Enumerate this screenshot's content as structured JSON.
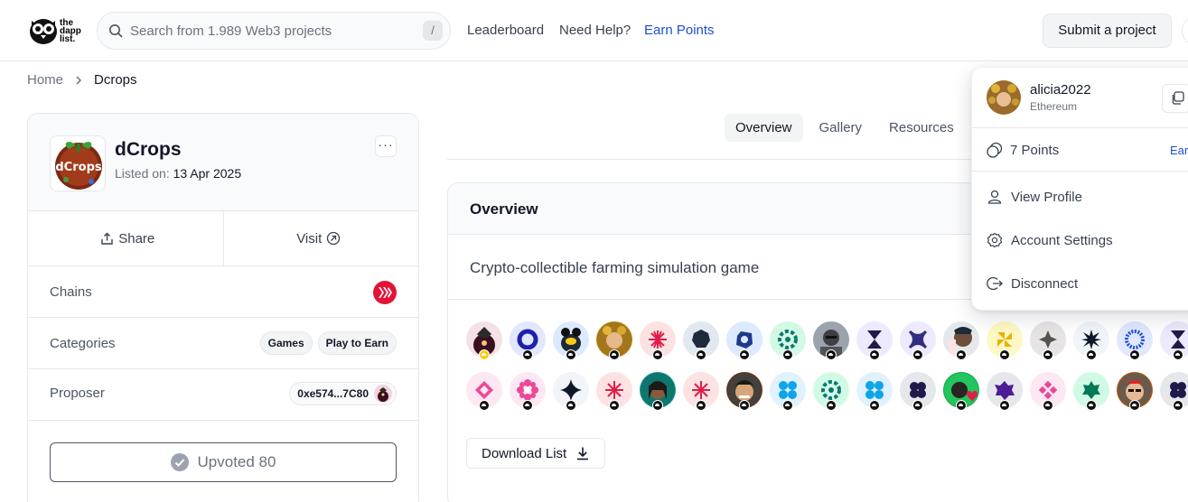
{
  "header": {
    "logo_lines": [
      "the",
      "dapp",
      "list."
    ],
    "search_placeholder": "Search from 1.989 Web3 projects",
    "search_shortcut": "/",
    "nav": [
      "Leaderboard",
      "Need Help?",
      "Earn Points"
    ],
    "submit_label": "Submit a project"
  },
  "breadcrumb": {
    "home": "Home",
    "current": "Dcrops"
  },
  "project": {
    "name": "dCrops",
    "listed_prefix": "Listed on:",
    "listed_date": "13 Apr 2025",
    "more": "···",
    "share_label": "Share",
    "visit_label": "Visit",
    "chains_label": "Chains",
    "categories_label": "Categories",
    "categories": [
      "Games",
      "Play to Earn"
    ],
    "proposer_label": "Proposer",
    "proposer_address": "0xe574...7C80",
    "upvote_label": "Upvoted 80",
    "chain_color": "#e31337"
  },
  "tabs": [
    "Overview",
    "Gallery",
    "Resources"
  ],
  "overview": {
    "title": "Overview",
    "description": "Crypto-collectible farming simulation game",
    "download_label": "Download List"
  },
  "dropdown": {
    "username": "alicia2022",
    "chain": "Ethereum",
    "points": "7 Points",
    "earn": "Earn",
    "items": [
      "View Profile",
      "Account Settings",
      "Disconnect"
    ]
  },
  "colors": {
    "accent": "#1d4ed8",
    "border": "#e5e7eb"
  }
}
